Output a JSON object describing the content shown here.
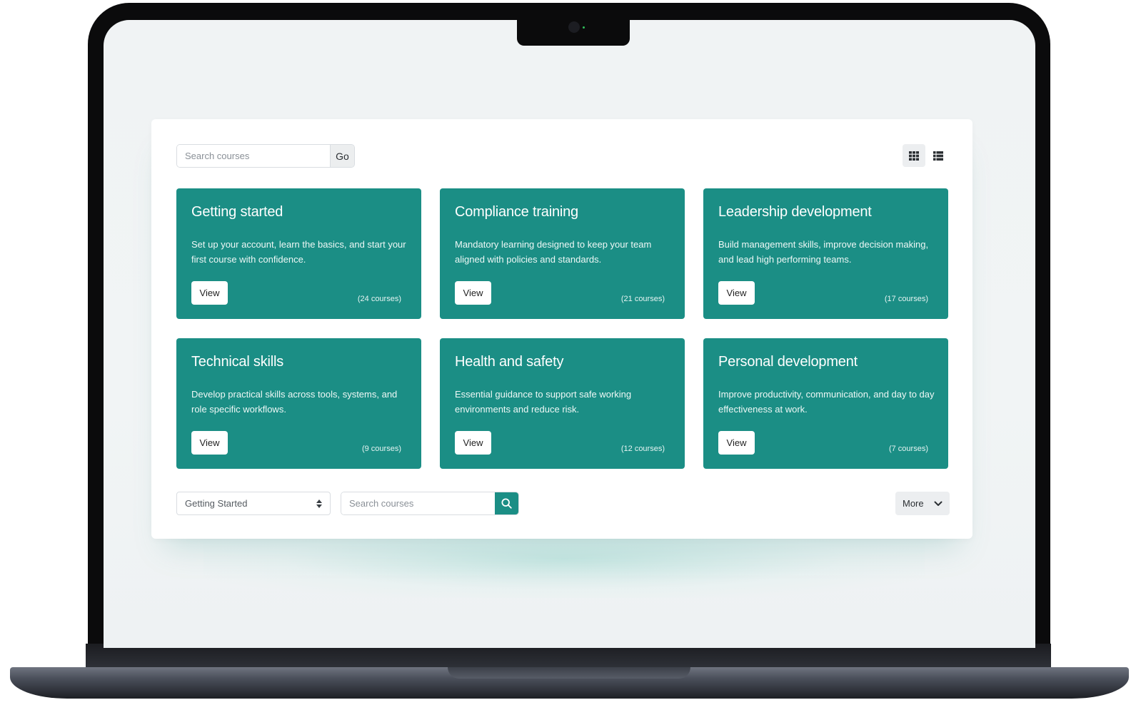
{
  "toolbar": {
    "search_placeholder": "Search courses",
    "go_label": "Go",
    "view_modes": [
      "grid-icon",
      "list-icon"
    ],
    "active_view": "grid"
  },
  "categories": [
    {
      "title": "Getting started",
      "description": "Set up your account, learn the basics, and start your first course with confidence.",
      "button": "View",
      "count": "(24 courses)"
    },
    {
      "title": "Compliance training",
      "description": "Mandatory learning designed to keep your team aligned with policies and standards.",
      "button": "View",
      "count": "(21 courses)"
    },
    {
      "title": "Leadership development",
      "description": "Build management skills, improve decision making, and lead high performing teams.",
      "button": "View",
      "count": "(17 courses)"
    },
    {
      "title": "Technical skills",
      "description": "Develop practical skills across tools, systems, and role specific workflows.",
      "button": "View",
      "count": "(9 courses)"
    },
    {
      "title": "Health and safety",
      "description": "Essential guidance to support safe working environments and reduce risk.",
      "button": "View",
      "count": "(12 courses)"
    },
    {
      "title": "Personal development",
      "description": "Improve productivity, communication, and day to day effectiveness at work.",
      "button": "View",
      "count": "(7 courses)"
    }
  ],
  "bottom": {
    "category_select": "Getting Started",
    "search_placeholder": "Search courses",
    "more_label": "More"
  },
  "colors": {
    "accent": "#1b8e85",
    "panel": "#ffffff",
    "screen_bg": "#f0f3f4"
  }
}
